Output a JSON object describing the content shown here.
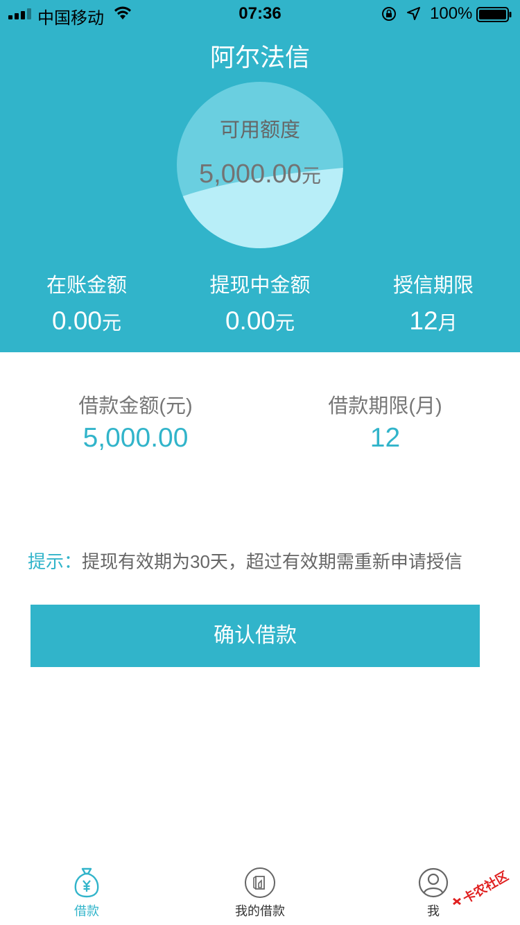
{
  "status_bar": {
    "carrier": "中国移动",
    "time": "07:36",
    "battery_pct": "100%"
  },
  "app_title": "阿尔法信",
  "credit": {
    "label": "可用额度",
    "amount": "5,000.00",
    "unit": "元"
  },
  "stats": [
    {
      "label": "在账金额",
      "value": "0.00",
      "unit": "元"
    },
    {
      "label": "提现中金额",
      "value": "0.00",
      "unit": "元"
    },
    {
      "label": "授信期限",
      "value": "12",
      "unit": "月"
    }
  ],
  "loan": {
    "amount_label": "借款金额(元)",
    "amount_value": "5,000.00",
    "term_label": "借款期限(月)",
    "term_value": "12"
  },
  "tip": {
    "label": "提示：",
    "text": "提现有效期为30天，超过有效期需重新申请授信"
  },
  "confirm_button": "确认借款",
  "tabbar": [
    {
      "label": "借款",
      "icon": "money-bag-icon",
      "active": true
    },
    {
      "label": "我的借款",
      "icon": "document-icon",
      "active": false
    },
    {
      "label": "我",
      "icon": "user-icon",
      "active": false
    }
  ],
  "watermark": "卡农社区",
  "colors": {
    "accent": "#31b4ca",
    "wave": "#b8eef8",
    "white": "#ffffff"
  }
}
